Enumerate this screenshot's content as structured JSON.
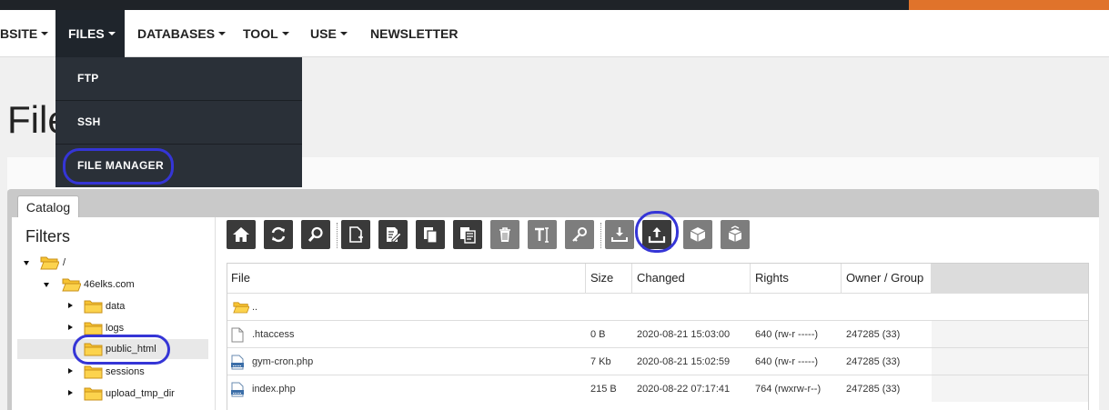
{
  "nav": {
    "items": [
      {
        "label": "BSITE",
        "caret": true
      },
      {
        "label": "FILES",
        "caret": true,
        "active": true
      },
      {
        "label": "DATABASES",
        "caret": true
      },
      {
        "label": "TOOL",
        "caret": true
      },
      {
        "label": "USE",
        "caret": true
      },
      {
        "label": "NEWSLETTER",
        "caret": false
      }
    ],
    "dropdown": [
      "FTP",
      "SSH",
      "FILE MANAGER"
    ]
  },
  "page": {
    "title": "File"
  },
  "panel": {
    "tab": "Catalog",
    "filters_title": "Filters"
  },
  "tree": {
    "root": "/",
    "domain": "46elks.com",
    "folders": [
      "data",
      "logs",
      "public_html",
      "sessions",
      "upload_tmp_dir"
    ],
    "selected": "public_html"
  },
  "toolbar": {
    "icons": [
      "home-icon",
      "refresh-icon",
      "search-icon",
      "new-file-icon",
      "edit-icon",
      "copy-icon",
      "paste-icon",
      "delete-icon",
      "rename-icon",
      "permissions-icon",
      "download-icon",
      "upload-icon",
      "archive-icon",
      "extract-icon"
    ],
    "highlighted": "upload-icon"
  },
  "files": {
    "columns": [
      "File",
      "Size",
      "Changed",
      "Rights",
      "Owner / Group"
    ],
    "parent": "..",
    "rows": [
      {
        "name": ".htaccess",
        "size": "0 B",
        "changed": "2020-08-21 15:03:00",
        "rights": "640 (rw-r -----)",
        "owner": "247285 (33)",
        "type": "text"
      },
      {
        "name": "gym-cron.php",
        "size": "7 Kb",
        "changed": "2020-08-21 15:02:59",
        "rights": "640 (rw-r -----)",
        "owner": "247285 (33)",
        "type": "php"
      },
      {
        "name": "index.php",
        "size": "215 B",
        "changed": "2020-08-22 07:17:41",
        "rights": "764 (rwxrw-r--)",
        "owner": "247285 (33)",
        "type": "php"
      }
    ]
  },
  "colors": {
    "accent": "#e0732b",
    "navDark": "#1f252c",
    "highlight": "#3535d6",
    "folder": "#f7c331"
  }
}
